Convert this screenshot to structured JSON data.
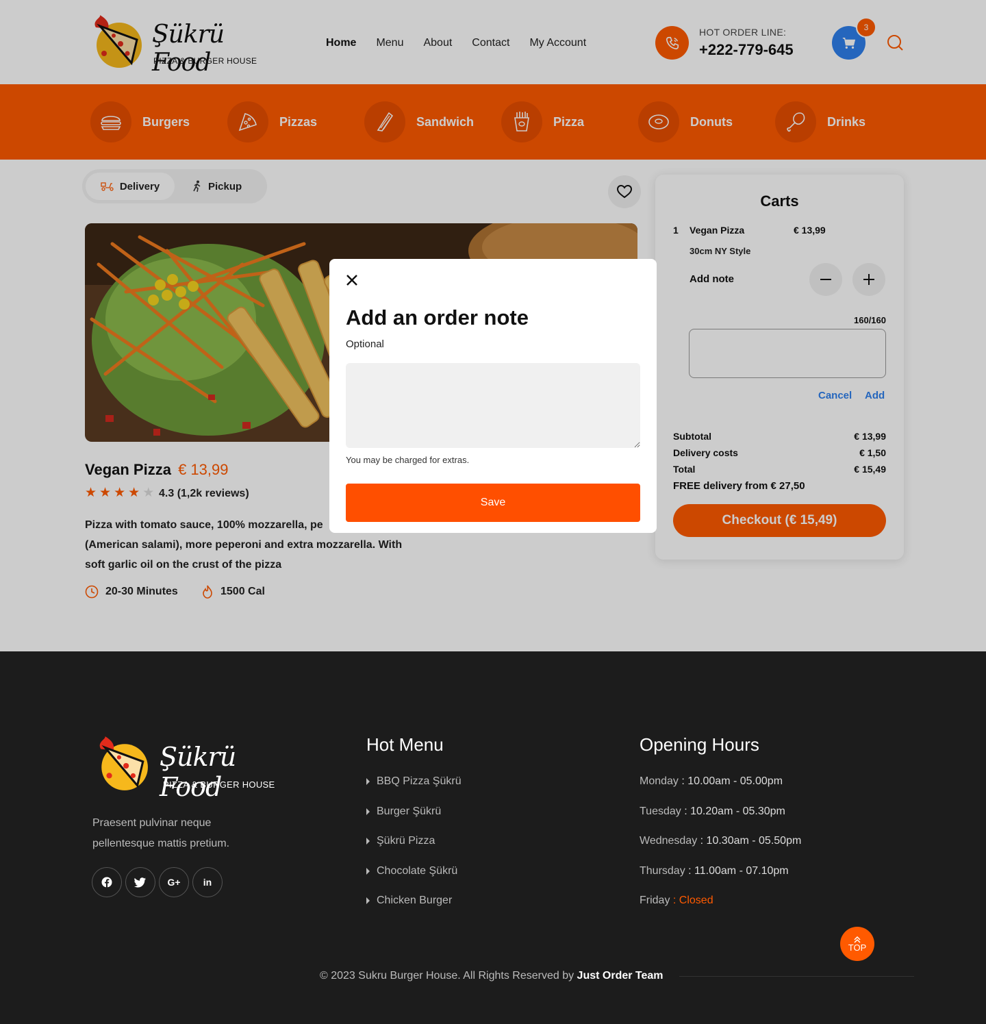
{
  "header": {
    "brand": "Şükrü Food",
    "tagline": "PIZZA & BURGER HOUSE",
    "nav": [
      "Home",
      "Menu",
      "About",
      "Contact",
      "My Account"
    ],
    "hotline_label": "HOT ORDER LINE:",
    "hotline_number": "+222-779-645",
    "cart_count": "3",
    "accent": "#ff5a00"
  },
  "categories": [
    "Burgers",
    "Pizzas",
    "Sandwich",
    "Pizza",
    "Donuts",
    "Drinks"
  ],
  "order_mode": {
    "delivery": "Delivery",
    "pickup": "Pickup"
  },
  "product": {
    "name": "Vegan Pizza",
    "price": "€ 13,99",
    "rating_stars": 4,
    "rating_text": "4.3 (1,2k reviews)",
    "description": "Pizza with tomato sauce, 100% mozzarella, pe",
    "description_line2": "(American salami), more peperoni and extra mozzarella. With",
    "description_line3": "soft garlic oil on the crust of the pizza",
    "time": "20-30 Minutes",
    "calories": "1500 Cal"
  },
  "cart": {
    "title": "Carts",
    "qty": "1",
    "item": "Vegan Pizza",
    "item_price": "€ 13,99",
    "variant": "30cm NY Style",
    "add_note": "Add note",
    "counter": "160/160",
    "cancel": "Cancel",
    "add": "Add",
    "subtotal_label": "Subtotal",
    "subtotal": "€ 13,99",
    "delivery_label": "Delivery costs",
    "delivery": "€ 1,50",
    "total_label": "Total",
    "total": "€ 15,49",
    "free_delivery": "FREE delivery from € 27,50",
    "checkout": "Checkout (€ 15,49)"
  },
  "modal": {
    "title": "Add an order note",
    "subtitle": "Optional",
    "hint": "You may be charged for extras.",
    "save": "Save"
  },
  "footer": {
    "brand": "Şükrü Food",
    "tagline": "PIZZA & BURGER HOUSE",
    "desc1": "Praesent pulvinar neque",
    "desc2": "pellentesque mattis pretium.",
    "social": [
      "facebook-icon",
      "twitter-icon",
      "google-plus-icon",
      "linkedin-icon"
    ],
    "hot_menu_title": "Hot Menu",
    "hot_menu": [
      "BBQ Pizza Şükrü",
      "Burger Şükrü",
      "Şükrü Pizza",
      "Chocolate Şükrü",
      "Chicken Burger"
    ],
    "hours_title": "Opening Hours",
    "hours": [
      {
        "day": "Monday",
        "time": ": 10.00am - 05.00pm"
      },
      {
        "day": "Tuesday",
        "time": ": 10.20am - 05.30pm"
      },
      {
        "day": "Wednesday",
        "time": ": 10.30am - 05.50pm"
      },
      {
        "day": "Thursday",
        "time": ": 11.00am - 07.10pm"
      },
      {
        "day": "Friday",
        "time": ": Closed"
      }
    ],
    "top": "TOP",
    "copyright": "© 2023 Sukru Burger House. All Rights Reserved by",
    "team": "Just Order Team"
  }
}
